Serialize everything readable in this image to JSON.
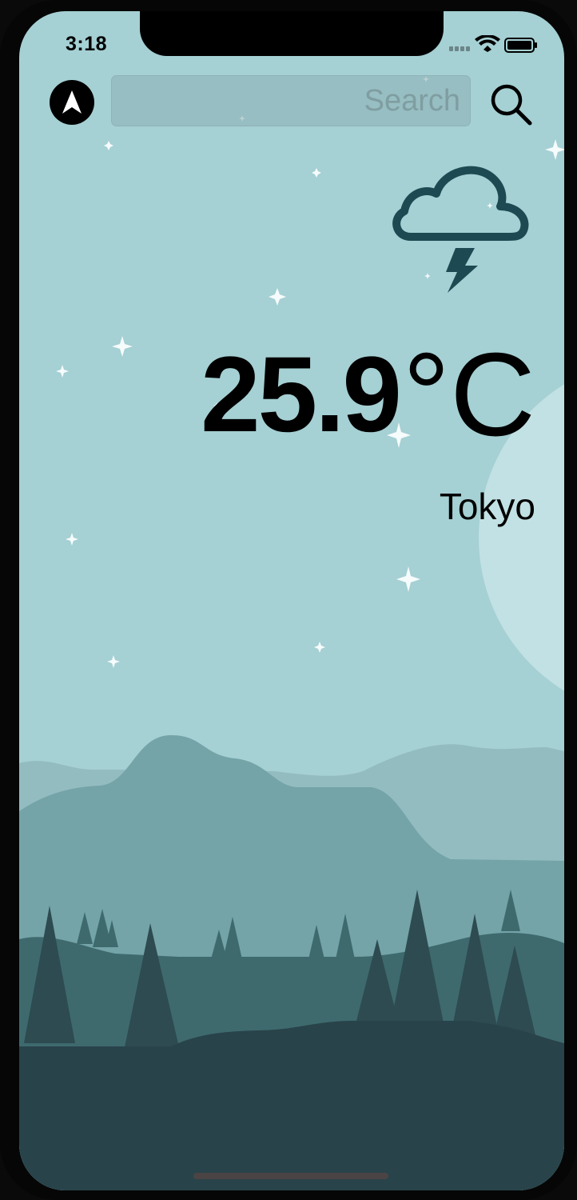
{
  "status_bar": {
    "time": "3:18",
    "signal_icon": "cellular-signal-icon",
    "wifi_icon": "wifi-icon",
    "battery_icon": "battery-icon"
  },
  "toolbar": {
    "location_icon": "location-arrow-icon",
    "search_placeholder": "Search",
    "search_value": "",
    "search_icon": "magnifier-icon"
  },
  "weather": {
    "condition_icon": "thunderstorm-cloud-icon",
    "temperature": "25.9",
    "unit": "°C",
    "city": "Tokyo"
  },
  "colors": {
    "sky": "#a5d0d4",
    "moon": "#c2e1e4",
    "hills_far": "#93bcc1",
    "hills_mid": "#74a4a8",
    "forest": "#3e6a6e",
    "ground": "#29434a",
    "icon_dark": "#1d4a52"
  }
}
